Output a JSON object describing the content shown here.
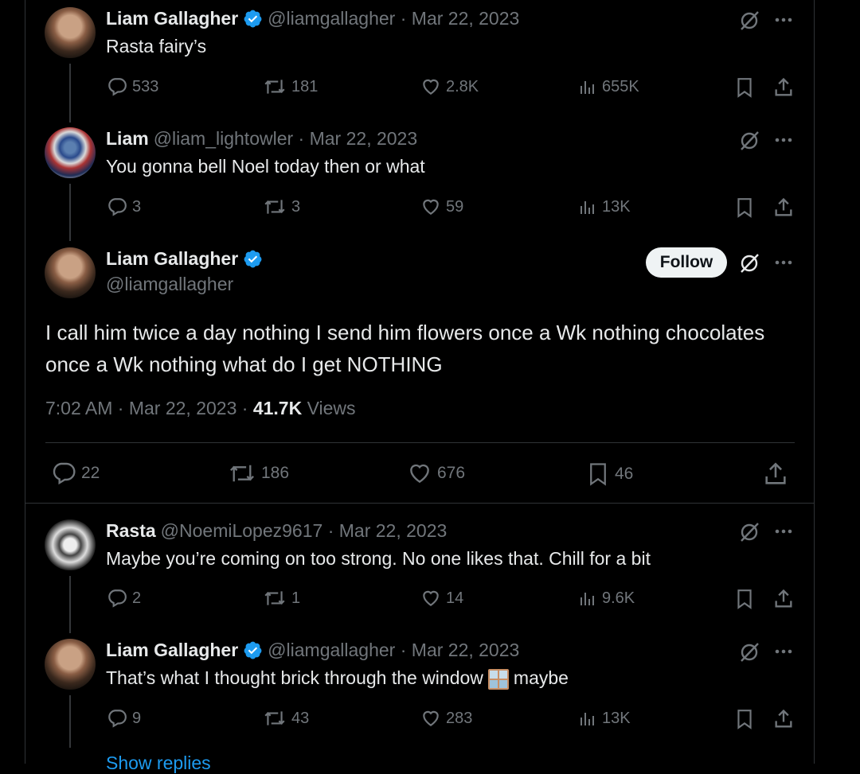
{
  "tweets": [
    {
      "name": "Liam Gallagher",
      "verified": true,
      "handle": "@liamgallagher",
      "date": "Mar 22, 2023",
      "text": "Rasta fairy’s",
      "replies": "533",
      "retweets": "181",
      "likes": "2.8K",
      "views": "655K"
    },
    {
      "name": "Liam",
      "verified": false,
      "handle": "@liam_lightowler",
      "date": "Mar 22, 2023",
      "text": "You gonna bell Noel today then or what",
      "replies": "3",
      "retweets": "3",
      "likes": "59",
      "views": "13K"
    }
  ],
  "main_tweet": {
    "name": "Liam Gallagher",
    "handle": "@liamgallagher",
    "follow_label": "Follow",
    "text_line1": "I call him twice a day nothing I send him flowers once a Wk nothing chocolates",
    "text_line2": "once a Wk nothing what do I get NOTHING",
    "time": "7:02 AM",
    "date": "Mar 22, 2023",
    "views_count": "41.7K",
    "views_label": "Views",
    "replies": "22",
    "retweets": "186",
    "likes": "676",
    "bookmarks": "46"
  },
  "replies": [
    {
      "name": "Rasta",
      "handle": "@NoemiLopez9617",
      "date": "Mar 22, 2023",
      "text": "Maybe you’re coming on too strong. No one likes that. Chill for a bit",
      "replies": "2",
      "retweets": "1",
      "likes": "14",
      "views": "9.6K"
    },
    {
      "name": "Liam Gallagher",
      "handle": "@liamgallagher",
      "date": "Mar 22, 2023",
      "text_before": "That’s what I thought brick through the window",
      "text_after": "maybe",
      "emoji": "window-emoji",
      "replies": "9",
      "retweets": "43",
      "likes": "283",
      "views": "13K"
    }
  ],
  "show_replies_label": "Show replies",
  "colors": {
    "background": "#000000",
    "text": "#e7e9ea",
    "muted": "#71767b",
    "verified": "#1d9bf0",
    "border": "#2f3336"
  }
}
